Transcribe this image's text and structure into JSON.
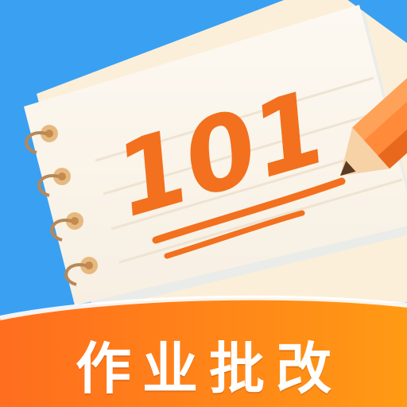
{
  "app_icon": {
    "score_text": "101",
    "banner_title": "作业批改",
    "icon_names": [
      "spiral-notebook-icon",
      "pencil-icon"
    ],
    "colors": {
      "background": "#3aa0f2",
      "notebook_paper": "#fbf6ec",
      "back_paper": "#fbefd9",
      "ink_orange": "#f2701e",
      "banner_orange": "#ff7a17",
      "ring_gold": "#d9a86a",
      "banner_text": "#ffffff"
    }
  }
}
